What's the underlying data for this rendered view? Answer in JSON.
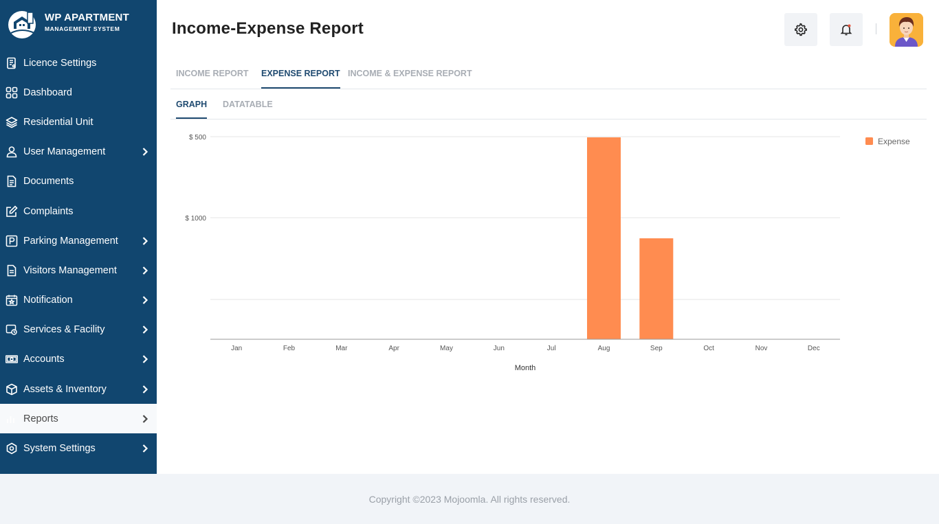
{
  "brand": {
    "title": "WP APARTMENT",
    "subtitle": "MANAGEMENT SYSTEM"
  },
  "sidebar": {
    "items": [
      {
        "label": "Licence Settings",
        "icon": "licence-icon",
        "chevron": false,
        "active": false
      },
      {
        "label": "Dashboard",
        "icon": "dashboard-icon",
        "chevron": false,
        "active": false
      },
      {
        "label": "Residential Unit",
        "icon": "layers-icon",
        "chevron": false,
        "active": false
      },
      {
        "label": "User Management",
        "icon": "user-icon",
        "chevron": true,
        "active": false
      },
      {
        "label": "Documents",
        "icon": "document-icon",
        "chevron": false,
        "active": false
      },
      {
        "label": "Complaints",
        "icon": "edit-icon",
        "chevron": false,
        "active": false
      },
      {
        "label": "Parking Management",
        "icon": "parking-icon",
        "chevron": true,
        "active": false
      },
      {
        "label": "Visitors Management",
        "icon": "file-icon",
        "chevron": true,
        "active": false
      },
      {
        "label": "Notification",
        "icon": "calendar-star-icon",
        "chevron": true,
        "active": false
      },
      {
        "label": "Services & Facility",
        "icon": "service-icon",
        "chevron": true,
        "active": false
      },
      {
        "label": "Accounts",
        "icon": "money-icon",
        "chevron": true,
        "active": false
      },
      {
        "label": "Assets & Inventory",
        "icon": "box-icon",
        "chevron": true,
        "active": false
      },
      {
        "label": "Reports",
        "icon": "report-icon",
        "chevron": true,
        "active": true
      },
      {
        "label": "System Settings",
        "icon": "settings-icon",
        "chevron": true,
        "active": false
      }
    ]
  },
  "header": {
    "title": "Income-Expense Report"
  },
  "tabs": [
    {
      "label": "INCOME REPORT",
      "active": false
    },
    {
      "label": "EXPENSE REPORT",
      "active": true
    },
    {
      "label": "INCOME & EXPENSE REPORT",
      "active": false
    }
  ],
  "subtabs": [
    {
      "label": "GRAPH",
      "active": true
    },
    {
      "label": "DATATABLE",
      "active": false
    }
  ],
  "chart_data": {
    "type": "bar",
    "categories": [
      "Jan",
      "Feb",
      "Mar",
      "Apr",
      "May",
      "Jun",
      "Jul",
      "Aug",
      "Sep",
      "Oct",
      "Nov",
      "Dec"
    ],
    "series": [
      {
        "name": "Expense",
        "color": "#ff8c50",
        "values": [
          0,
          0,
          0,
          0,
          0,
          0,
          0,
          1000,
          500,
          0,
          0,
          0
        ]
      }
    ],
    "yticks": [
      "$ 500",
      "$ 1000"
    ],
    "xlabel": "Month",
    "ylabel": "",
    "grid": true,
    "legend": "top-right"
  },
  "footer": {
    "text": "Copyright ©2023 Mojoomla. All rights reserved."
  }
}
